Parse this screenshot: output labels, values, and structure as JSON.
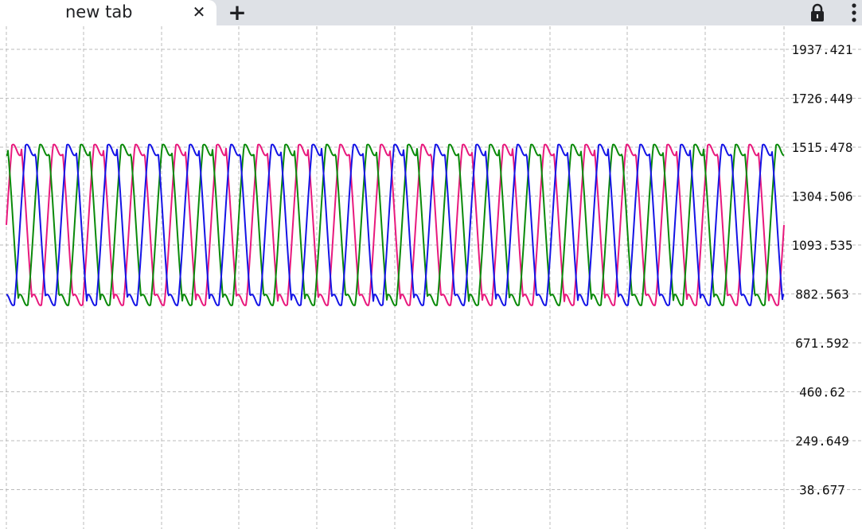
{
  "browser": {
    "tab_title": "new tab",
    "close_icon": "close-icon",
    "new_tab_icon": "plus-icon",
    "lock_icon": "lock-icon",
    "menu_icon": "kebab-menu-icon"
  },
  "chart_data": {
    "type": "line",
    "y_ticks": [
      "1937.421",
      "1726.449",
      "1515.478",
      "1304.506",
      "1093.535",
      "882.563",
      "671.592",
      "460.62",
      "249.649",
      "38.677"
    ],
    "ylim": [
      38.677,
      1937.421
    ],
    "y_axis_position": "right",
    "grid": true,
    "grid_style": "dashed",
    "legend": "none",
    "series": [
      {
        "color": "#e8197d",
        "min": 850,
        "max": 1510,
        "period_x": 3.18,
        "phase": 0.0
      },
      {
        "color": "#0a8a0a",
        "min": 850,
        "max": 1510,
        "period_x": 3.18,
        "phase": 2.094
      },
      {
        "color": "#1414e6",
        "min": 850,
        "max": 1510,
        "period_x": 3.18,
        "phase": 4.189
      }
    ],
    "x_cycles": 19,
    "colors": {
      "grid": "#bbbbbb",
      "tab_strip": "#dee1e6"
    }
  }
}
